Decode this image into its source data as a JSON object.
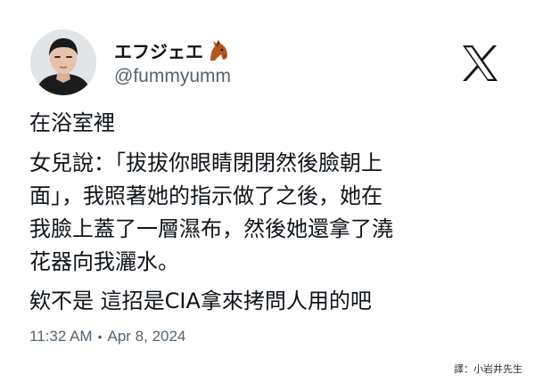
{
  "author": {
    "display_name": "エフジェエ",
    "name_icon": "horse-icon",
    "handle": "@fummyumm",
    "avatar_icon": "avatar"
  },
  "platform": {
    "logo_icon": "x-logo-icon"
  },
  "tweet": {
    "paragraphs": [
      "在浴室裡",
      "女兒說：「拔拔你眼睛閉閉然後臉朝上\n面」，我照著她的指示做了之後，她在\n我臉上蓋了一層濕布，然後她還拿了澆\n花器向我灑水。",
      "欸不是 這招是CIA拿來拷問人用的吧"
    ],
    "time": "11:32 AM",
    "separator": "•",
    "date": "Apr 8, 2024"
  },
  "credit": "譯：小岩井先生",
  "colors": {
    "text": "#0f1419",
    "secondary": "#536471",
    "background": "#ffffff"
  }
}
